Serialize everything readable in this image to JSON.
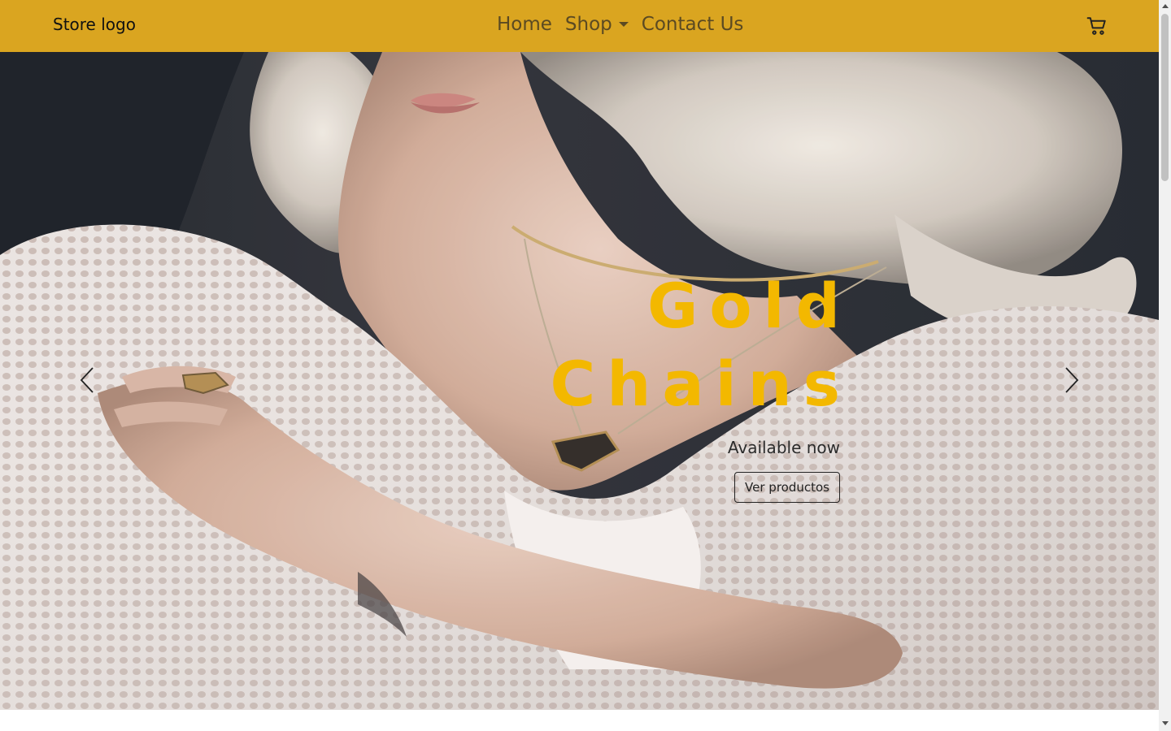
{
  "navbar": {
    "brand": "Store logo",
    "links": [
      {
        "label": "Home"
      },
      {
        "label": "Shop",
        "has_dropdown": true
      },
      {
        "label": "Contact Us"
      }
    ],
    "cart_icon": "cart-icon",
    "background": "#DAA520"
  },
  "hero": {
    "headline_line1": "Gold",
    "headline_line2": "Chains",
    "subtitle": "Available now",
    "button_label": "Ver productos",
    "headline_color": "#F3B800",
    "prev_icon": "chevron-left-icon",
    "next_icon": "chevron-right-icon"
  }
}
